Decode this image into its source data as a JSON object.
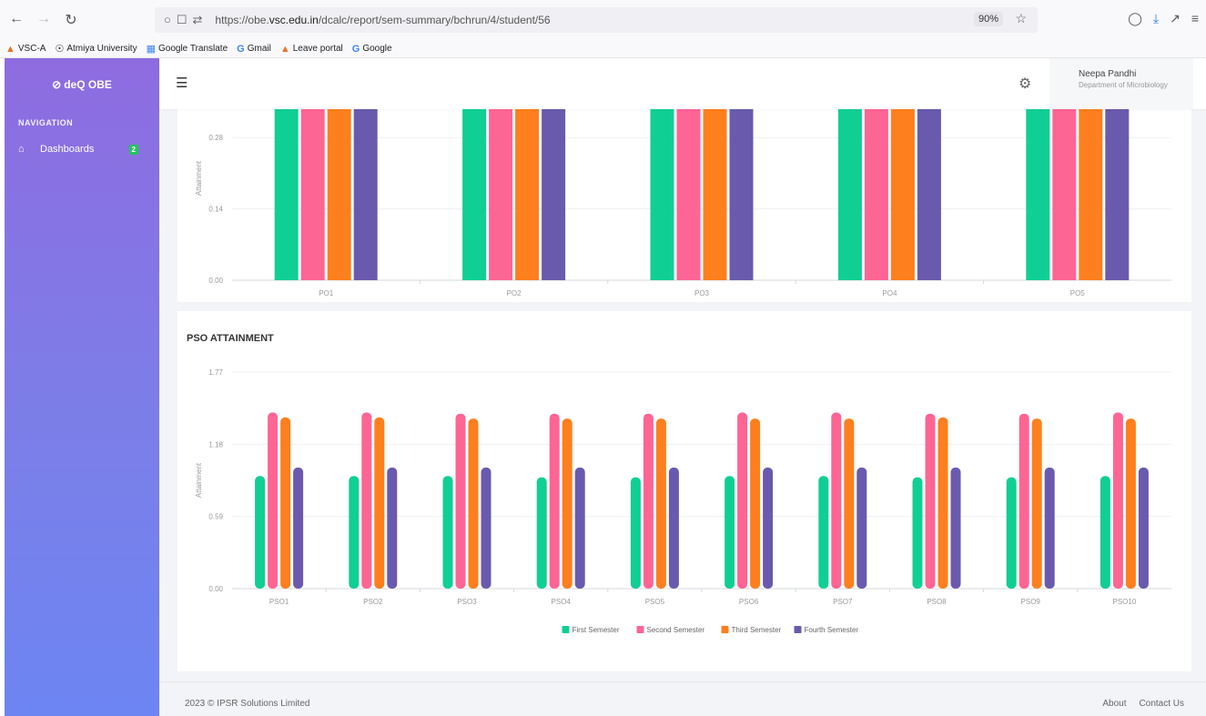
{
  "browser": {
    "url_prefix": "https://obe.",
    "url_domain": "vsc.edu.in",
    "url_path": "/dcalc/report/sem-summary/bchrun/4/student/56",
    "zoom": "90%",
    "bookmarks": [
      "VSC-A",
      "Atmiya University",
      "Google Translate",
      "Gmail",
      "Leave portal",
      "Google"
    ]
  },
  "sidebar": {
    "brand": "deQ OBE",
    "nav_title": "NAVIGATION",
    "items": [
      {
        "label": "Dashboards",
        "badge": "2"
      }
    ]
  },
  "topbar": {
    "user_name": "Neepa Pandhi",
    "user_dept": "Department of Microbiology"
  },
  "footer": {
    "copyright": "2023 © IPSR Solutions Limited",
    "links": [
      "About",
      "Contact Us"
    ]
  },
  "colors": {
    "first": "#10cf94",
    "second": "#fd6595",
    "third": "#fd7f1e",
    "fourth": "#6a5aad"
  },
  "chart_data": [
    {
      "type": "bar",
      "title": "",
      "ylabel": "Attainment",
      "categories": [
        "PO1",
        "PO2",
        "PO3",
        "PO4",
        "PO5"
      ],
      "yticks": [
        "0.00",
        "0.14",
        "0.28"
      ],
      "ylim": [
        0,
        0.4
      ],
      "legend_position": "bottom",
      "series": [
        {
          "name": "First Semester",
          "values": [
            0.4,
            0.4,
            0.4,
            0.4,
            0.4
          ]
        },
        {
          "name": "Second Semester",
          "values": [
            0.4,
            0.4,
            0.4,
            0.4,
            0.4
          ]
        },
        {
          "name": "Third Semester",
          "values": [
            0.4,
            0.4,
            0.4,
            0.4,
            0.4
          ]
        },
        {
          "name": "Fourth Semester",
          "values": [
            0.4,
            0.4,
            0.4,
            0.4,
            0.4
          ]
        }
      ]
    },
    {
      "type": "bar",
      "title": "PSO ATTAINMENT",
      "ylabel": "Attainment",
      "categories": [
        "PSO1",
        "PSO2",
        "PSO3",
        "PSO4",
        "PSO5",
        "PSO6",
        "PSO7",
        "PSO8",
        "PSO9",
        "PSO10"
      ],
      "yticks": [
        "0.00",
        "0.59",
        "1.18",
        "1.77"
      ],
      "ylim": [
        0,
        1.77
      ],
      "legend_position": "bottom",
      "series": [
        {
          "name": "First Semester",
          "values": [
            0.92,
            0.92,
            0.92,
            0.91,
            0.91,
            0.92,
            0.92,
            0.91,
            0.91,
            0.92
          ]
        },
        {
          "name": "Second Semester",
          "values": [
            1.44,
            1.44,
            1.43,
            1.43,
            1.43,
            1.44,
            1.44,
            1.43,
            1.43,
            1.44
          ]
        },
        {
          "name": "Third Semester",
          "values": [
            1.4,
            1.4,
            1.39,
            1.39,
            1.39,
            1.39,
            1.39,
            1.4,
            1.39,
            1.39
          ]
        },
        {
          "name": "Fourth Semester",
          "values": [
            0.99,
            0.99,
            0.99,
            0.99,
            0.99,
            0.99,
            0.99,
            0.99,
            0.99,
            0.99
          ]
        }
      ]
    }
  ]
}
